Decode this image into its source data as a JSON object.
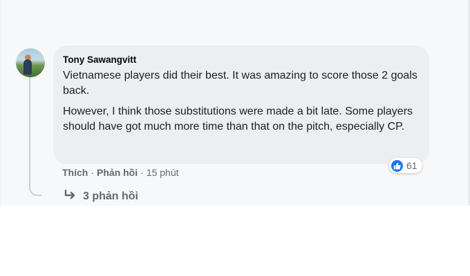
{
  "comment": {
    "author": "Tony Sawangvitt",
    "paragraphs": [
      "Vietnamese players did their best. It was amazing to score those 2 goals back.",
      "However, I think those substitutions were made a bit late. Some players should have got much more time than that on the pitch, especially CP."
    ],
    "reaction": {
      "icon": "like-icon",
      "count": "61"
    },
    "actions": {
      "like": "Thích",
      "reply": "Phản hồi",
      "separator": "·",
      "time": "15 phút"
    },
    "replies": {
      "icon": "reply-arrow-icon",
      "label": "3 phản hồi"
    }
  },
  "colors": {
    "bubble": "#eceef1",
    "background": "#f7f8fa",
    "meta_text": "#65676b",
    "like_blue": "#1877f2"
  }
}
